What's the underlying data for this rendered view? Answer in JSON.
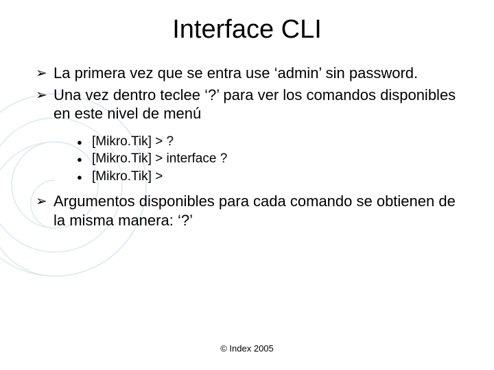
{
  "title": "Interface CLI",
  "bullets": {
    "b1": "La primera vez que se entra use ‘admin’ sin password.",
    "b2": "Una vez dentro teclee ‘?’ para ver los comandos disponibles en este nivel de menú",
    "b3": "Argumentos disponibles para cada comando se obtienen de la misma manera: ‘?’"
  },
  "sub": {
    "s1": "[Mikro.Tik] > ?",
    "s2": "[Mikro.Tik] > interface ?",
    "s3": "[Mikro.Tik] >"
  },
  "footer": "© Index 2005",
  "glyph": {
    "arrow": "➢",
    "dot": "●"
  }
}
